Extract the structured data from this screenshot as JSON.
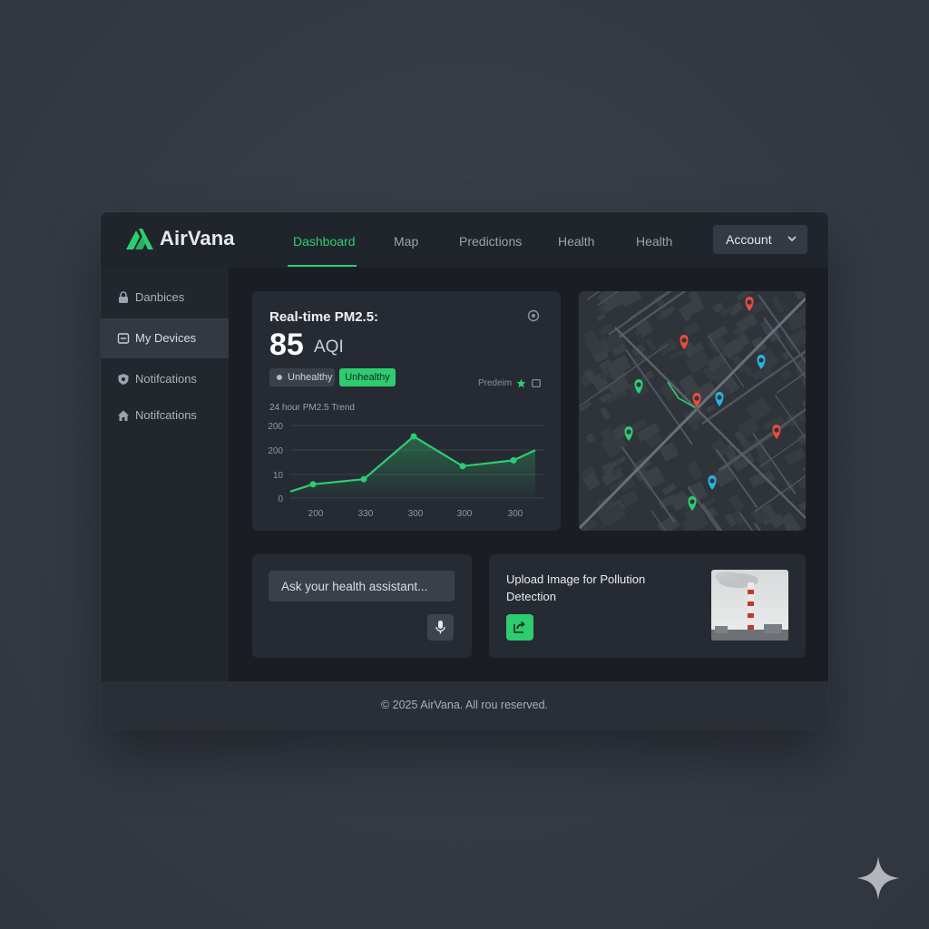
{
  "app": {
    "brand": "AirVana",
    "accent_color": "#2ecc71"
  },
  "nav": {
    "items": [
      {
        "label": "Dashboard",
        "active": true
      },
      {
        "label": "Map",
        "active": false
      },
      {
        "label": "Predictions",
        "active": false
      },
      {
        "label": "Health",
        "active": false
      },
      {
        "label": "Health",
        "active": false
      }
    ],
    "account_label": "Account"
  },
  "sidebar": {
    "items": [
      {
        "label": "Danbices",
        "icon": "lock-icon",
        "active": false
      },
      {
        "label": "My Devices",
        "icon": "device-icon",
        "active": true
      },
      {
        "label": "Notifcations",
        "icon": "shield-icon",
        "active": false
      },
      {
        "label": "Notifcations",
        "icon": "home-icon",
        "active": false
      }
    ]
  },
  "pm_card": {
    "title": "Real-time PM2.5:",
    "value": "85",
    "unit": "AQI",
    "badge_gray": "Unhealthy",
    "badge_green": "Unhealthy",
    "predeim_label": "Predeim",
    "trend_label": "24 hour PM2.5 Trend"
  },
  "chart_data": {
    "type": "area",
    "title": "24 hour PM2.5 Trend",
    "y_tick_labels": [
      "200",
      "200",
      "10",
      "0"
    ],
    "x_tick_labels": [
      "200",
      "330",
      "300",
      "300",
      "300"
    ],
    "points_relative": [
      0.09,
      0.19,
      0.26,
      0.85,
      0.44,
      0.52,
      0.66
    ],
    "grid": true,
    "line_color": "#2ecc71"
  },
  "map": {
    "markers": [
      {
        "color": "#e74c3c"
      },
      {
        "color": "#e74c3c"
      },
      {
        "color": "#e74c3c"
      },
      {
        "color": "#e74c3c"
      },
      {
        "color": "#2ecc71"
      },
      {
        "color": "#2ecc71"
      },
      {
        "color": "#2ecc71"
      },
      {
        "color": "#27b4e0"
      },
      {
        "color": "#27b4e0"
      },
      {
        "color": "#27b4e0"
      }
    ]
  },
  "chat": {
    "placeholder": "Ask your health assistant..."
  },
  "upload": {
    "title": "Upload Image for Pollution Detection"
  },
  "footer": {
    "text": "© 2025 AirVana. All rou reserved."
  }
}
